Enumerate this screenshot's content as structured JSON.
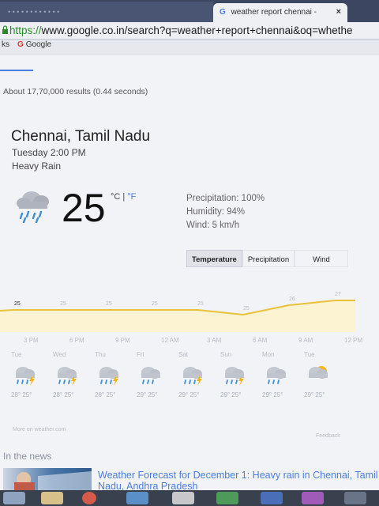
{
  "browser": {
    "inactive_tab_title": "• • • • • • • • • • • •",
    "active_tab_title": "weather report chennai - ",
    "close_symbol": "×",
    "url_scheme": "https://",
    "url_rest": "www.google.co.in/search?q=weather+report+chennai&oq=whethe",
    "bookmarks_prefix": "ks",
    "bookmark_google": "Google"
  },
  "search": {
    "results_stats": "About 17,70,000 results (0.44 seconds)"
  },
  "weather": {
    "location": "Chennai, Tamil Nadu",
    "datetime": "Tuesday 2:00 PM",
    "condition": "Heavy Rain",
    "temperature": "25",
    "unit_c": "°C",
    "unit_sep": "|",
    "unit_f": "°F",
    "precipitation": "Precipitation: 100%",
    "humidity": "Humidity: 94%",
    "wind": "Wind: 5 km/h",
    "tabs": [
      "Temperature",
      "Precipitation",
      "Wind"
    ],
    "graph_values": [
      "25",
      "25",
      "25",
      "25",
      "25",
      "25",
      "26",
      "27"
    ],
    "graph_series": [
      25,
      25,
      25,
      25,
      25,
      25,
      26,
      27
    ],
    "times": [
      "3 PM",
      "6 PM",
      "9 PM",
      "12 AM",
      "3 AM",
      "6 AM",
      "9 AM",
      "12 PM"
    ],
    "days": [
      {
        "name": "Tue",
        "icon": "rain-thunder-icon",
        "temps": "28° 25°"
      },
      {
        "name": "Wed",
        "icon": "rain-thunder-icon",
        "temps": "28° 25°"
      },
      {
        "name": "Thu",
        "icon": "rain-thunder-icon",
        "temps": "28° 25°"
      },
      {
        "name": "Fri",
        "icon": "rain-icon",
        "temps": "29° 25°"
      },
      {
        "name": "Sat",
        "icon": "rain-thunder-icon",
        "temps": "29° 25°"
      },
      {
        "name": "Sun",
        "icon": "rain-thunder-icon",
        "temps": "29° 25°"
      },
      {
        "name": "Mon",
        "icon": "rain-icon",
        "temps": "29° 25°"
      },
      {
        "name": "Tue",
        "icon": "partly-cloudy-icon",
        "temps": "29° 25°"
      }
    ],
    "more_link": "More on weather.com",
    "feedback": "Feedback"
  },
  "news": {
    "heading": "In the news",
    "title": "Weather Forecast for December 1: Heavy rain in Chennai, Tamil Nadu, Andhra Pradesh"
  },
  "colors": {
    "accent_blue": "#4a7de0",
    "graph_line": "#e8c23a",
    "graph_fill": "#fbf3d2",
    "rain_blue": "#3d8fd6",
    "lightning": "#f2b51e"
  }
}
